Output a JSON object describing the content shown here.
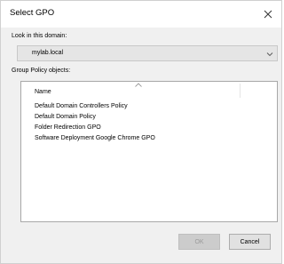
{
  "window": {
    "title": "Select GPO",
    "close_icon": "close-icon"
  },
  "domain": {
    "label": "Look in this domain:",
    "selected": "mylab.local"
  },
  "gpo_list": {
    "label": "Group Policy objects:",
    "column_header": "Name",
    "sort_direction": "ascending",
    "items": [
      "Default Domain Controllers Policy",
      "Default Domain Policy",
      "Folder Redirection GPO",
      "Software Deployment Google Chrome GPO"
    ]
  },
  "buttons": {
    "ok": "OK",
    "cancel": "Cancel"
  }
}
